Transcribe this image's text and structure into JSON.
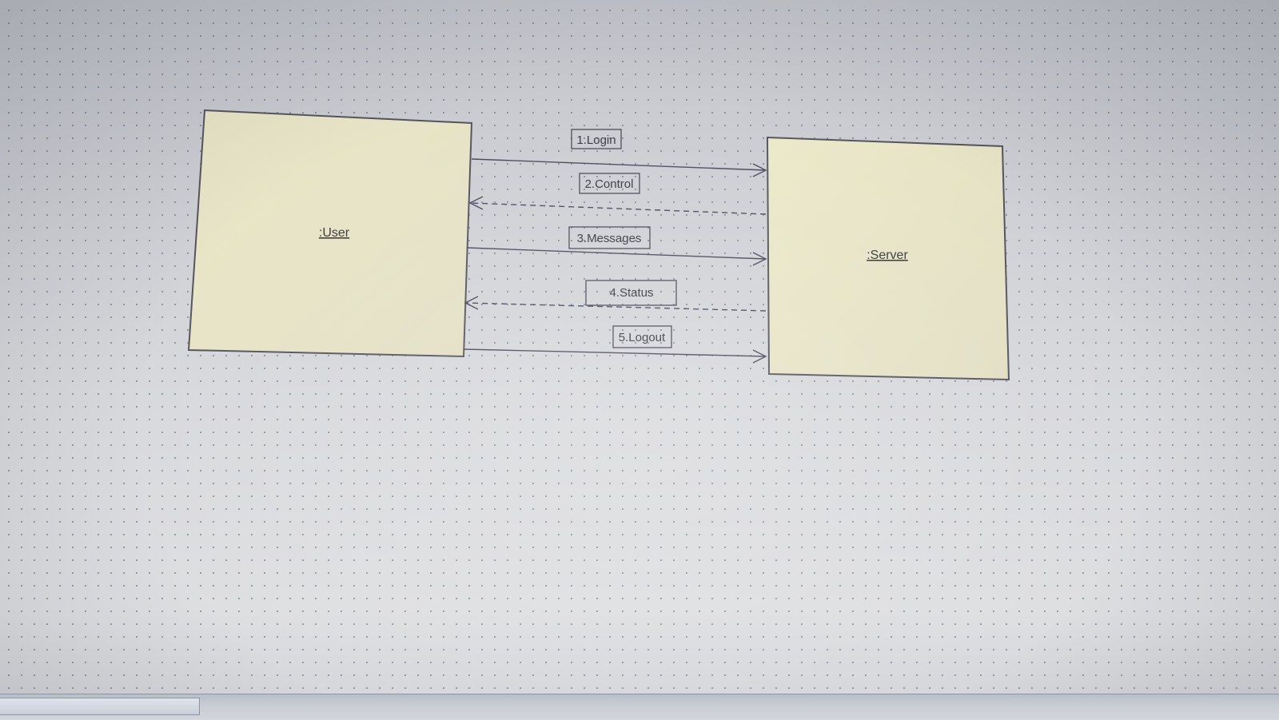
{
  "diagram": {
    "objects": {
      "user": {
        "label": ":User",
        "fill": "#e9e5c6"
      },
      "server": {
        "label": ":Server",
        "fill": "#e9e5c6"
      }
    },
    "messages": [
      {
        "label": "1.Login",
        "from": "user",
        "to": "server",
        "style": "solid"
      },
      {
        "label": "2.Control",
        "from": "server",
        "to": "user",
        "style": "dashed"
      },
      {
        "label": "3.Messages",
        "from": "user",
        "to": "server",
        "style": "solid"
      },
      {
        "label": "4.Status",
        "from": "server",
        "to": "user",
        "style": "dashed"
      },
      {
        "label": "5.Logout",
        "from": "user",
        "to": "server",
        "style": "solid"
      }
    ],
    "colors": {
      "line": "#4a4a60",
      "box_border": "#5a5a66",
      "object_fill": "#e9e5c6"
    }
  }
}
